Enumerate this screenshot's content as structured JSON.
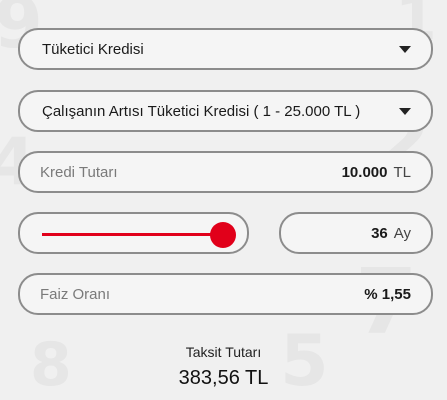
{
  "loan_type": {
    "selected": "Tüketici Kredisi",
    "caret_icon": "chevron-down-icon"
  },
  "loan_product": {
    "selected": "Çalışanın Artısı Tüketici Kredisi ( 1 - 25.000 TL )",
    "caret_icon": "chevron-down-icon"
  },
  "loan_amount": {
    "label": "Kredi Tutarı",
    "value": "10.000",
    "unit": "TL"
  },
  "term": {
    "slider_level": 1.0,
    "value": "36",
    "unit": "Ay",
    "accent_color": "#e1001a"
  },
  "interest": {
    "label": "Faiz Oranı",
    "value": "% 1,55"
  },
  "installment": {
    "label": "Taksit Tutarı",
    "value": "383,56 TL"
  }
}
